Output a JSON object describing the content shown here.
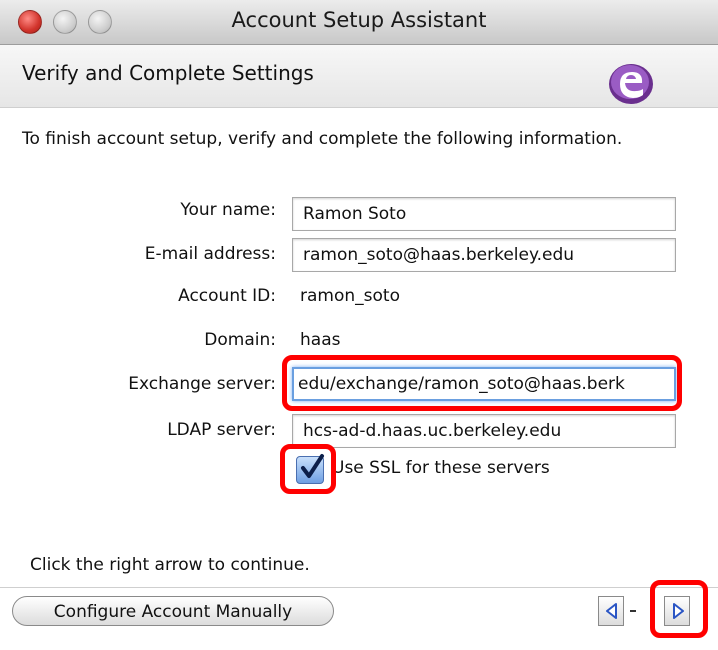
{
  "window": {
    "title": "Account Setup Assistant"
  },
  "header": {
    "title": "Verify and Complete Settings",
    "logo_icon": "entourage-logo-icon"
  },
  "intro": "To finish account setup, verify and complete the following information.",
  "form": {
    "name_label": "Your name:",
    "name_value": "Ramon Soto",
    "email_label": "E-mail address:",
    "email_value": "ramon_soto@haas.berkeley.edu",
    "account_id_label": "Account ID:",
    "account_id_value": "ramon_soto",
    "domain_label": "Domain:",
    "domain_value": "haas",
    "exchange_label": "Exchange server:",
    "exchange_value": "edu/exchange/ramon_soto@haas.berk",
    "ldap_label": "LDAP server:",
    "ldap_value": "hcs-ad-d.haas.uc.berkeley.edu",
    "ssl_label": "Use SSL for these servers",
    "ssl_checked": true
  },
  "hint": "Click the right arrow to continue.",
  "footer": {
    "configure_label": "Configure Account Manually",
    "prev_icon": "left-arrow-icon",
    "next_icon": "right-arrow-icon"
  },
  "colors": {
    "highlight": "#ff0000",
    "focus_ring": "#6a9fe0",
    "logo": "#7a3d9e"
  }
}
